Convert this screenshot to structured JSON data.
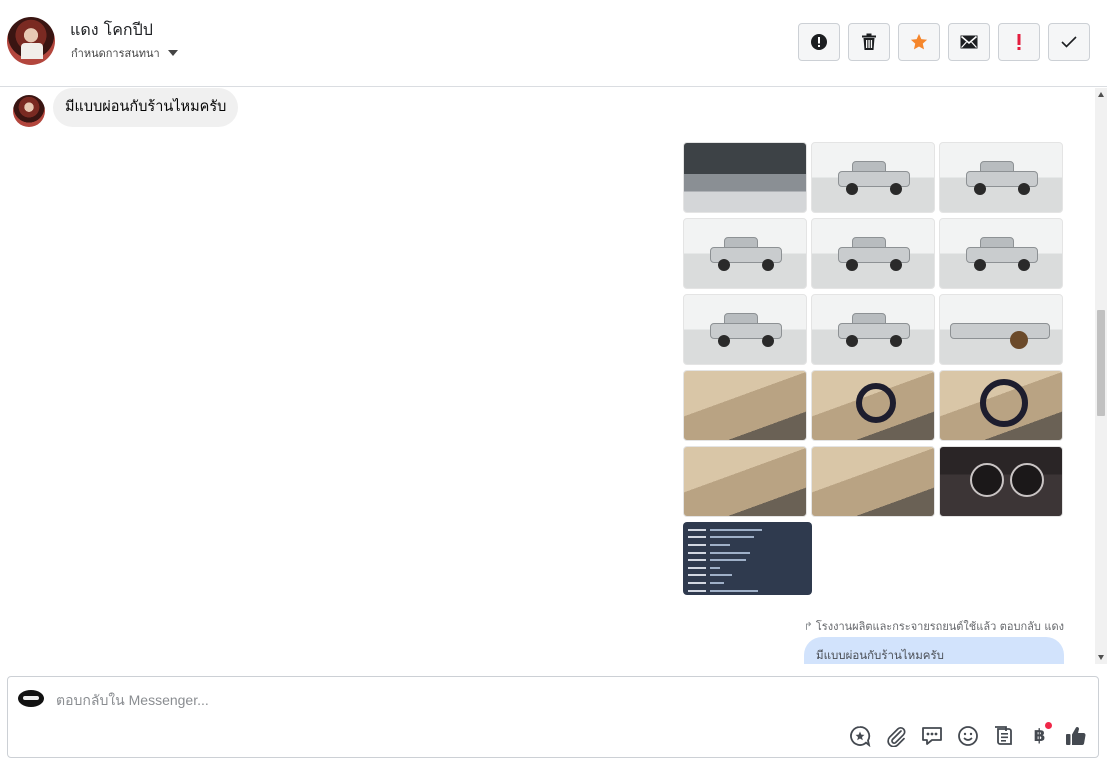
{
  "header": {
    "contact_name": "แดง โคกปีป",
    "conversation_menu_label": "กำหนดการสนทนา",
    "actions": [
      {
        "name": "mark-spam-button",
        "icon": "alert-circle-icon"
      },
      {
        "name": "delete-button",
        "icon": "trash-icon"
      },
      {
        "name": "star-button",
        "icon": "star-icon"
      },
      {
        "name": "mark-unread-button",
        "icon": "envelope-icon"
      },
      {
        "name": "follow-up-button",
        "icon": "exclamation-icon"
      },
      {
        "name": "mark-done-button",
        "icon": "check-icon"
      }
    ]
  },
  "messages": {
    "incoming_text": "มีแบบผ่อนกับร้านไหมครับ",
    "photo_count": 16,
    "reply_note": "โรงงานผลิตและกระจายรถยนต์ใช้แล้ว ตอบกลับ แดง",
    "outgoing_quoted_text": "มีแบบผ่อนกับร้านไหมครับ"
  },
  "composer": {
    "placeholder": "ตอบกลับใน Messenger...",
    "tools": [
      "saved-reply-icon",
      "attachment-icon",
      "message-options-icon",
      "emoji-icon",
      "catalog-icon",
      "payment-baht-icon",
      "like-icon"
    ],
    "baht_symbol": "฿",
    "notification_color": "#f02849"
  },
  "colors": {
    "star": "#f5862c",
    "alert_red": "#e41e3f",
    "outgoing_bubble": "#d2e3fc",
    "incoming_bubble": "#f0f0f0"
  }
}
